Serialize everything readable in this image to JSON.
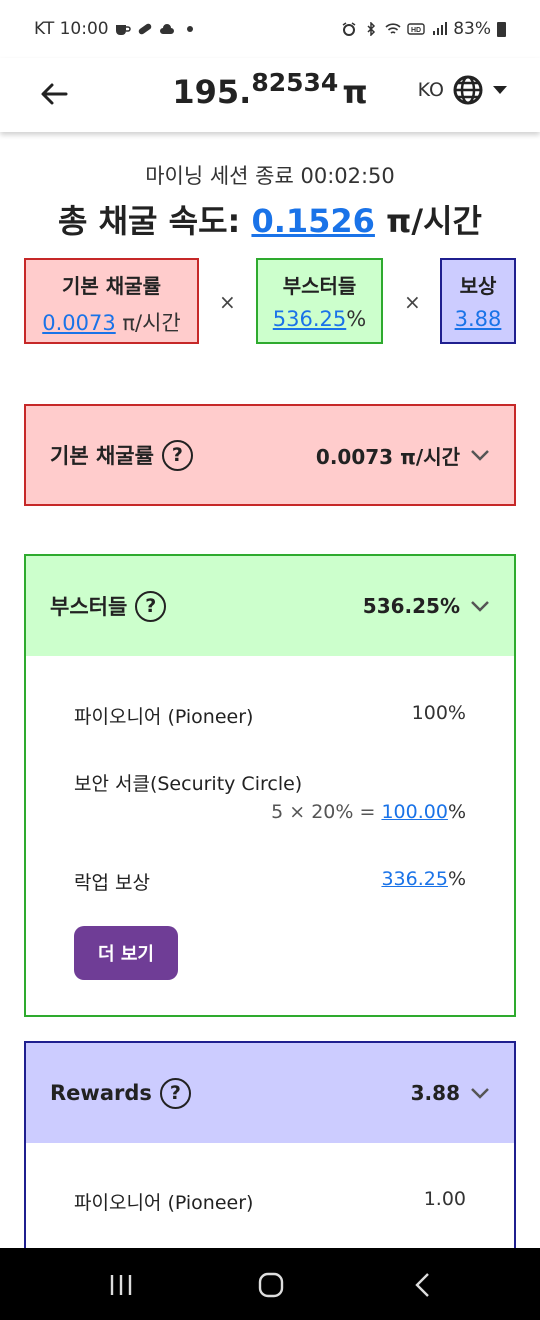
{
  "status_bar": {
    "time": "KT 10:00",
    "battery": "83%"
  },
  "header": {
    "balance_int": "195.",
    "balance_frac": "82534",
    "currency": "π",
    "lang": "KO"
  },
  "summary": {
    "session_text": "마이닝 세션 종료 00:02:50",
    "total_label": "총 채굴 속도: ",
    "total_value": "0.1526",
    "total_unit": " π/시간"
  },
  "factors": {
    "base_title": "기본 채굴률",
    "base_value": "0.0073",
    "base_unit": " π/시간",
    "times": "×",
    "boost_title": "부스터들",
    "boost_value": "536.25",
    "boost_unit": "%",
    "reward_title": "보상",
    "reward_value": "3.88"
  },
  "panels": {
    "base": {
      "title": "기본 채굴률",
      "help": "?",
      "value": "0.0073 π/시간"
    },
    "boosters": {
      "title": "부스터들",
      "help": "?",
      "value": "536.25%",
      "pioneer_label": "파이오니어 (Pioneer)",
      "pioneer_value": "100%",
      "security_label": "보안 서클(Security Circle)",
      "security_calc_prefix": "5 × 20% = ",
      "security_calc_value": "100.00",
      "security_calc_unit": "%",
      "lockup_label": "락업 보상",
      "lockup_value": "336.25",
      "lockup_unit": "%",
      "more_button": "더 보기"
    },
    "rewards": {
      "title": "Rewards",
      "help": "?",
      "value": "3.88",
      "pioneer_label": "파이오니어 (Pioneer)",
      "pioneer_value": "1.00"
    }
  },
  "colors": {
    "link": "#1a73e8",
    "base_bg": "#ffcccc",
    "base_border": "#c62828",
    "boost_bg": "#ccffcc",
    "boost_border": "#2eaa2e",
    "reward_bg": "#ccccff",
    "reward_border": "#1f1f8f",
    "button": "#6f3d96"
  }
}
